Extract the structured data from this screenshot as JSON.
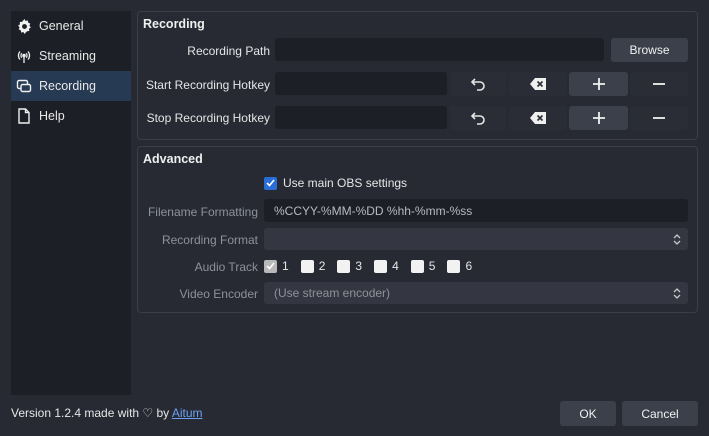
{
  "sidebar": {
    "items": [
      {
        "label": "General",
        "icon": "gear-icon",
        "active": false
      },
      {
        "label": "Streaming",
        "icon": "antenna-icon",
        "active": false
      },
      {
        "label": "Recording",
        "icon": "recording-icon",
        "active": true
      },
      {
        "label": "Help",
        "icon": "document-icon",
        "active": false
      }
    ]
  },
  "recording": {
    "title": "Recording",
    "path_label": "Recording Path",
    "path_value": "",
    "browse_label": "Browse",
    "start_label": "Start Recording Hotkey",
    "stop_label": "Stop Recording Hotkey"
  },
  "advanced": {
    "title": "Advanced",
    "use_main_label": "Use main OBS settings",
    "use_main_checked": true,
    "filename_label": "Filename Formatting",
    "filename_value": "%CCYY-%MM-%DD %hh-%mm-%ss",
    "format_label": "Recording Format",
    "format_value": "",
    "audio_label": "Audio Track",
    "tracks": [
      "1",
      "2",
      "3",
      "4",
      "5",
      "6"
    ],
    "encoder_label": "Video Encoder",
    "encoder_value": "(Use stream encoder)"
  },
  "footer": {
    "version_text": "Version 1.2.4 made with ♡ by",
    "link_text": "Aitum",
    "ok_label": "OK",
    "cancel_label": "Cancel"
  },
  "colors": {
    "background": "#272a33",
    "sidebar": "#1d1f26",
    "active_item": "#263a53",
    "accent": "#2a6dd6",
    "link": "#6ba2f2"
  }
}
